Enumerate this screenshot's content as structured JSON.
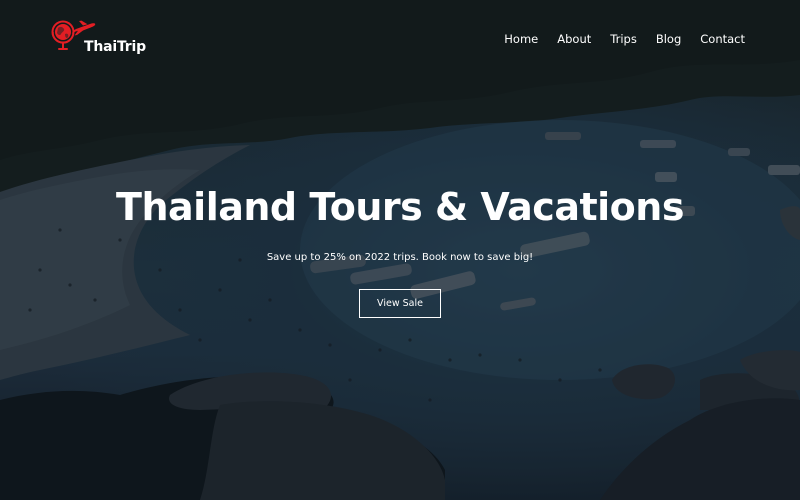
{
  "brand": {
    "name": "ThaiTrip",
    "icon": "globe-with-airplane-icon",
    "accent_color": "#e31e24"
  },
  "nav": {
    "items": [
      {
        "label": "Home"
      },
      {
        "label": "About"
      },
      {
        "label": "Trips"
      },
      {
        "label": "Blog"
      },
      {
        "label": "Contact"
      }
    ]
  },
  "hero": {
    "title": "Thailand Tours & Vacations",
    "subtitle": "Save up to 25% on 2022 trips. Book now to save big!",
    "cta_label": "View Sale",
    "background": "dark-tinted-beach-bay-photo"
  }
}
